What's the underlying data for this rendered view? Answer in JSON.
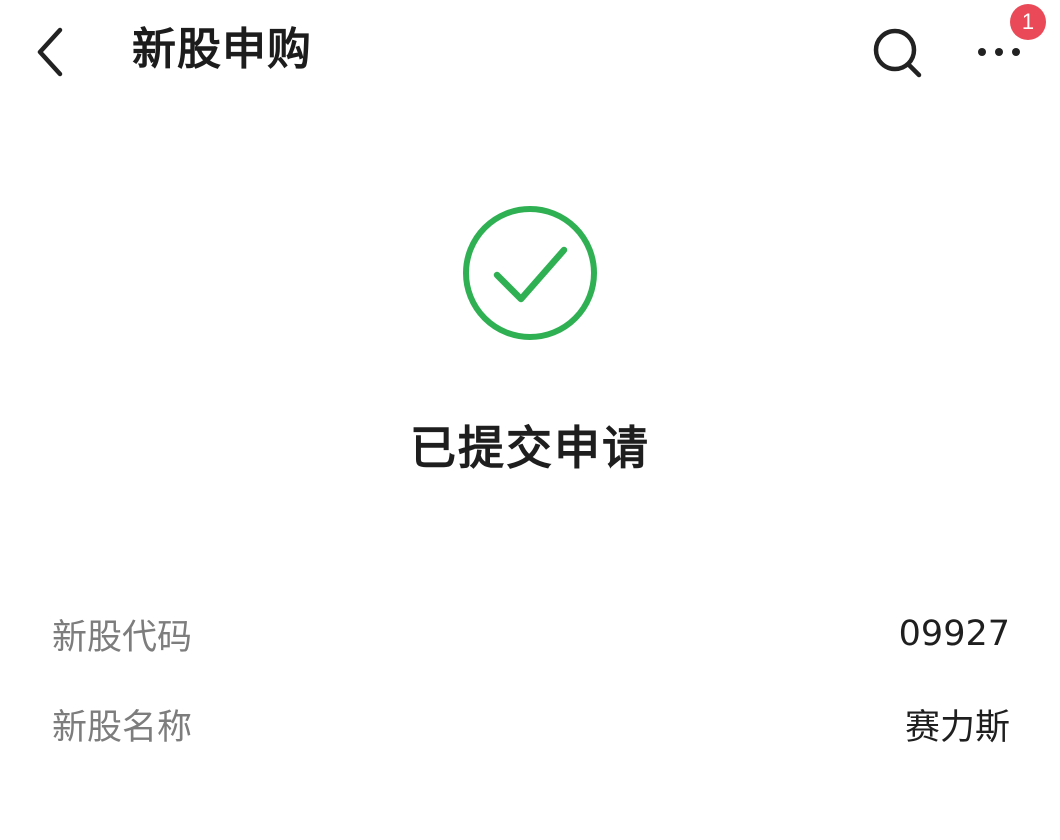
{
  "header": {
    "title": "新股申购",
    "back_icon": "chevron-left-icon",
    "search_icon": "search-icon",
    "more_icon": "more-horizontal-icon",
    "notification_badge_count": "1",
    "badge_color": "#ea4a57"
  },
  "result": {
    "icon": "check-circle-icon",
    "icon_color": "#2fb052",
    "status_text": "已提交申请"
  },
  "details": [
    {
      "label": "新股代码",
      "value": "09927"
    },
    {
      "label": "新股名称",
      "value": "赛力斯"
    },
    {
      "label": "",
      "value": ""
    }
  ]
}
